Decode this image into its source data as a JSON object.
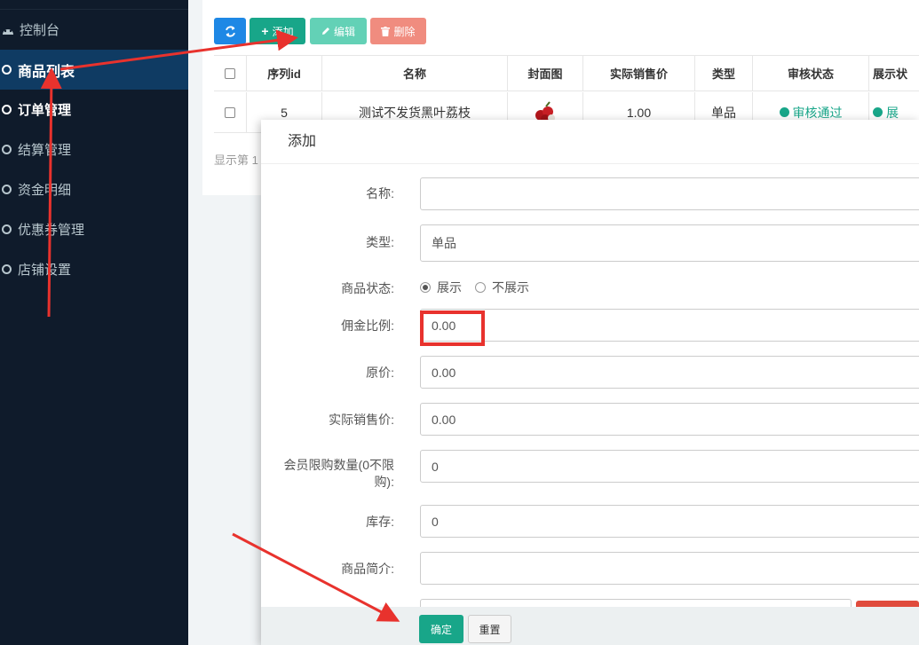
{
  "sidebar": {
    "items": [
      {
        "label": "控制台",
        "icon": "dashboard-icon"
      },
      {
        "label": "商品列表",
        "icon": "circle-icon"
      },
      {
        "label": "订单管理",
        "icon": "circle-icon"
      },
      {
        "label": "结算管理",
        "icon": "circle-icon"
      },
      {
        "label": "资金明细",
        "icon": "circle-icon"
      },
      {
        "label": "优惠券管理",
        "icon": "circle-icon"
      },
      {
        "label": "店铺设置",
        "icon": "circle-icon"
      }
    ]
  },
  "toolbar": {
    "refresh_icon": "refresh-icon",
    "add_label": "添加",
    "edit_label": "编辑",
    "delete_label": "删除"
  },
  "table": {
    "headers": [
      "序列id",
      "名称",
      "封面图",
      "实际销售价",
      "类型",
      "审核状态",
      "展示状"
    ],
    "rows": [
      {
        "id": "5",
        "name": "测试不发货黑叶荔枝",
        "price": "1.00",
        "type": "单品",
        "status": "审核通过",
        "display": "展"
      }
    ]
  },
  "pagination": {
    "text": "显示第 1"
  },
  "modal": {
    "title": "添加",
    "fields": {
      "name": {
        "label": "名称:",
        "value": ""
      },
      "type": {
        "label": "类型:",
        "value": "单品"
      },
      "state": {
        "label": "商品状态:",
        "options": [
          "展示",
          "不展示"
        ],
        "selected": "展示"
      },
      "commission": {
        "label": "佣金比例:",
        "value": "0.00"
      },
      "original_price": {
        "label": "原价:",
        "value": "0.00"
      },
      "sale_price": {
        "label": "实际销售价:",
        "value": "0.00"
      },
      "limit_line1": "会员限购数量(0不限",
      "limit_line2": "购):",
      "limit_value": "0",
      "stock": {
        "label": "库存:",
        "value": "0"
      },
      "intro": {
        "label": "商品简介:",
        "value": ""
      }
    },
    "confirm_label": "确定",
    "reset_label": "重置"
  },
  "colors": {
    "sidebar_bg": "#0f1b2b",
    "sidebar_active": "#0f3b63",
    "primary_green": "#18a689",
    "annotation_red": "#e8322d"
  }
}
